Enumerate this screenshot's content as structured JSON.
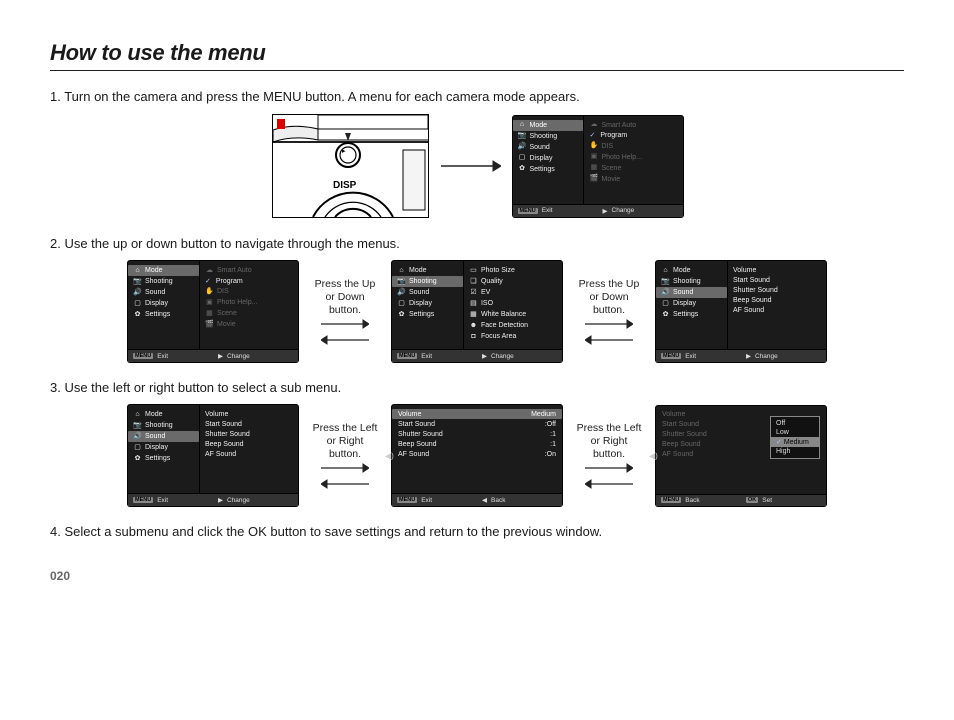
{
  "title": "How to use the menu",
  "page_number": "020",
  "steps": {
    "s1": "1. Turn on the camera and press the MENU button. A menu for each camera mode appears.",
    "s2": "2. Use the up or down button to navigate through the menus.",
    "s3": "3. Use the left or right button to select a sub menu.",
    "s4": "4. Select a submenu and click the OK button to save settings and return to the previous window."
  },
  "captions": {
    "updown": "Press the Up or Down button.",
    "leftright": "Press the Left or Right button."
  },
  "left_menu": {
    "mode": "Mode",
    "shooting": "Shooting",
    "sound": "Sound",
    "display": "Display",
    "settings": "Settings"
  },
  "mode_sub": {
    "smart_auto": "Smart Auto",
    "program": "Program",
    "dis": "DIS",
    "photo_help": "Photo Help...",
    "scene": "Scene",
    "movie": "Movie"
  },
  "shooting_sub": {
    "photo_size": "Photo Size",
    "quality": "Quality",
    "ev": "EV",
    "iso": "ISO",
    "wb": "White Balance",
    "face": "Face Detection",
    "focus": "Focus Area"
  },
  "sound_sub": {
    "volume": "Volume",
    "start_sound": "Start Sound",
    "shutter_sound": "Shutter Sound",
    "beep_sound": "Beep Sound",
    "af_sound": "AF Sound"
  },
  "sound_values": {
    "volume": "Medium",
    "start_sound": ":Off",
    "shutter_sound": ":1",
    "beep_sound": ":1",
    "af_sound": ":On"
  },
  "volume_options": {
    "off": "Off",
    "low": "Low",
    "medium": "Medium",
    "high": "High"
  },
  "footer": {
    "menu": "MENU",
    "exit": "Exit",
    "change": "Change",
    "back": "Back",
    "ok": "OK",
    "set": "Set"
  },
  "camera_label": "DISP"
}
